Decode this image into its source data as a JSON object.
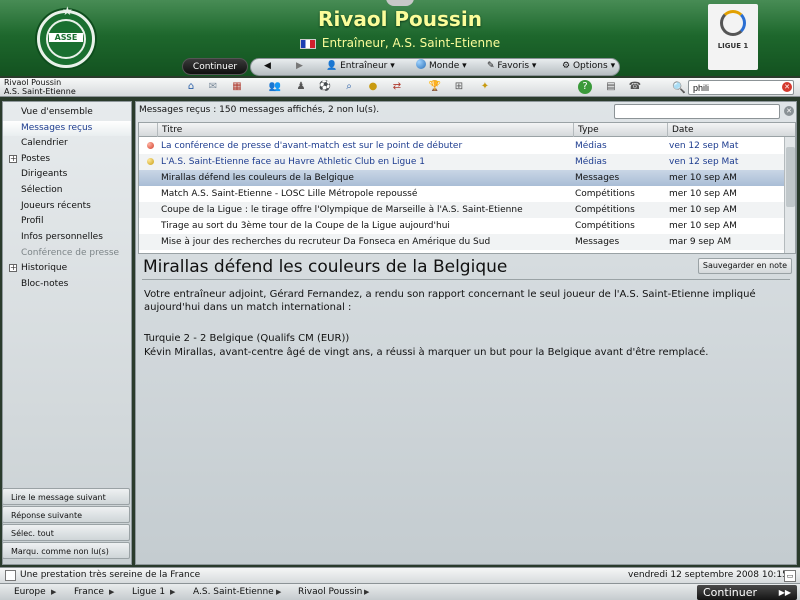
{
  "header": {
    "manager_name": "Rivaol Poussin",
    "manager_role": "Entraîneur, A.S. Saint-Etienne",
    "club_logo_text": "ASSE",
    "league_logo_text": "LIGUE 1"
  },
  "toolbar1": {
    "continue_label": "Continuer",
    "entraineur_label": "Entraîneur",
    "monde_label": "Monde",
    "favoris_label": "Favoris",
    "options_label": "Options"
  },
  "toolbar2": {
    "manager_label": "Rivaol Poussin",
    "club_label": "A.S. Saint-Etienne",
    "search_value": "phili"
  },
  "sidebar": {
    "items": [
      {
        "label": "Vue d'ensemble"
      },
      {
        "label": "Messages reçus"
      },
      {
        "label": "Calendrier"
      },
      {
        "label": "Postes"
      },
      {
        "label": "Dirigeants"
      },
      {
        "label": "Sélection"
      },
      {
        "label": "Joueurs récents"
      },
      {
        "label": "Profil"
      },
      {
        "label": "Infos personnelles"
      },
      {
        "label": "Conférence de presse"
      },
      {
        "label": "Historique"
      },
      {
        "label": "Bloc-notes"
      }
    ],
    "actions": [
      {
        "label": "Lire le message suivant"
      },
      {
        "label": "Réponse suivante"
      },
      {
        "label": "Sélec. tout"
      },
      {
        "label": "Marqu. comme non lu(s)"
      }
    ]
  },
  "main": {
    "count_text": "Messages reçus : 150 messages affichés, 2 non lu(s).",
    "columns": {
      "titre": "Titre",
      "type": "Type",
      "date": "Date"
    },
    "rows": [
      {
        "title": "La conférence de presse d'avant-match est sur le point de débuter",
        "type": "Médias",
        "date": "ven 12 sep Mat"
      },
      {
        "title": "L'A.S. Saint-Etienne face au Havre Athletic Club en Ligue 1",
        "type": "Médias",
        "date": "ven 12 sep Mat"
      },
      {
        "title": "Mirallas défend les couleurs de la Belgique",
        "type": "Messages",
        "date": "mer 10 sep AM"
      },
      {
        "title": "Match A.S. Saint-Etienne - LOSC Lille Métropole repoussé",
        "type": "Compétitions",
        "date": "mer 10 sep AM"
      },
      {
        "title": "Coupe de la Ligue : le tirage offre l'Olympique de Marseille à l'A.S. Saint-Etienne",
        "type": "Compétitions",
        "date": "mer 10 sep AM"
      },
      {
        "title": "Tirage au sort du 3ème tour de la Coupe de la Ligue aujourd'hui",
        "type": "Compétitions",
        "date": "mer 10 sep AM"
      },
      {
        "title": "Mise à jour des recherches du recruteur Da Fonseca en Amérique du Sud",
        "type": "Messages",
        "date": "mar 9 sep AM"
      }
    ],
    "article": {
      "title": "Mirallas défend les couleurs de la Belgique",
      "save_label": "Sauvegarder en note",
      "para1": "Votre entraîneur adjoint, Gérard Fernandez, a rendu son rapport concernant le seul joueur de l'A.S. Saint-Etienne impliqué aujourd'hui dans un match international :",
      "para2": "Turquie 2 - 2 Belgique (Qualifs CM (EUR))",
      "para3": "Kévin Mirallas, avant-centre âgé de vingt ans, a réussi à marquer un but pour la Belgique avant d'être remplacé."
    }
  },
  "status": {
    "text": "Une prestation très sereine de la France",
    "datetime": "vendredi 12 septembre 2008 10:15"
  },
  "breadcrumbs": {
    "items": [
      {
        "label": "Europe"
      },
      {
        "label": "France"
      },
      {
        "label": "Ligue 1"
      },
      {
        "label": "A.S. Saint-Etienne"
      },
      {
        "label": "Rivaol Poussin"
      }
    ],
    "continue_label": "Continuer"
  },
  "colors": {
    "header_green": "#1f6a2e",
    "title_yellow": "#fbfd9a",
    "unread_blue": "#1d3c8f",
    "selected_row": "#a9bdd6"
  }
}
